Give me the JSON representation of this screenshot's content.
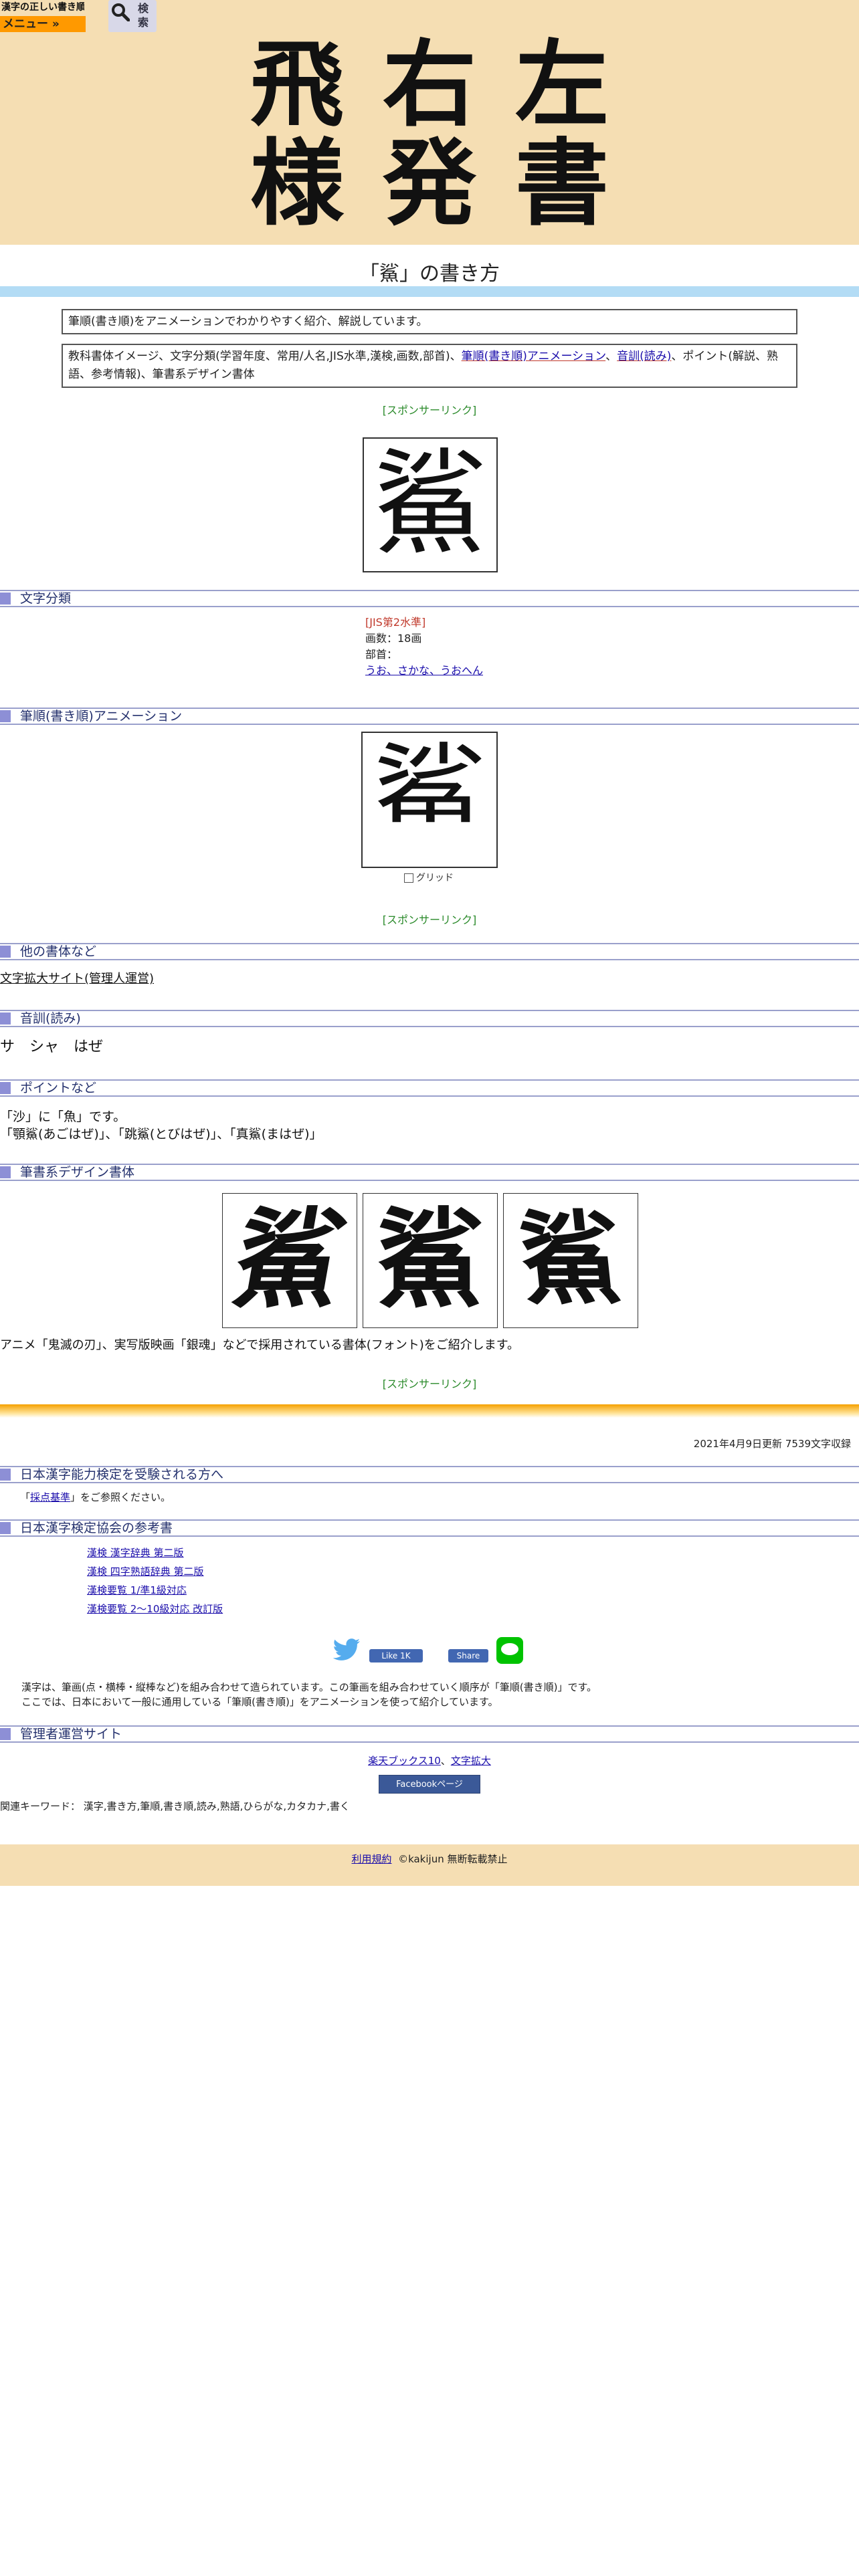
{
  "header": {
    "logo": "漢字の正しい書き順(筆順)",
    "menu_label": "メニュー »",
    "search_label": "検索"
  },
  "banner": {
    "chars_row1": [
      "飛",
      "右",
      "左"
    ],
    "chars_row2": [
      "様",
      "発",
      "書"
    ]
  },
  "page_title": "「鯊」の書き方",
  "intro": "筆順(書き順)をアニメーションでわかりやすく紹介、解説しています。",
  "contents_menu": {
    "prefix": "教科書体イメージ、文字分類(学習年度、常用/人名,JIS水準,漢検,画数,部首)、",
    "link1": "筆順(書き順)アニメーション",
    "sep": "、",
    "link2": "音訓(読み)",
    "suffix": "、ポイント(解説、熟語、参考情報)、筆書系デザイン書体"
  },
  "sponsor_label": "[スポンサーリンク]",
  "kanji": "鯊",
  "kanji_partial": "鯊",
  "sections": {
    "classification": "文字分類",
    "animation": "筆順(書き順)アニメーション",
    "other_fonts": "他の書体など",
    "readings": "音訓(読み)",
    "points": "ポイントなど",
    "brush_fonts": "筆書系デザイン書体",
    "kanken": "日本漢字能力検定を受験される方へ",
    "kanken_refs": "日本漢字検定協会の参考書",
    "admin_sites": "管理者運営サイト"
  },
  "classification": {
    "jis": "[JIS第2水準]",
    "strokes": "画数：18画",
    "radical_label": "部首：",
    "radical": "うお、さかな、うおへん"
  },
  "grid_label": "グリッド",
  "other_fonts_link": "文字拡大サイト(管理人運営)",
  "readings": "サ　シャ　はぜ",
  "points": {
    "line1": "「沙」に「魚」です。",
    "line2": "「顎鯊(あごはぜ)」、「跳鯊(とびはぜ)」、「真鯊(まはぜ)」"
  },
  "brush_note": "アニメ「鬼滅の刃」、実写版映画「銀魂」などで採用されている書体(フォント)をご紹介します。",
  "updated": "2021年4月9日更新 7539文字収録",
  "kanken_note_pre": "「",
  "kanken_note_link": "採点基準",
  "kanken_note_post": "」をご参照ください。",
  "kanken_refs": [
    "漢検 漢字辞典 第二版",
    "漢検 四字熟語辞典 第二版",
    "漢検要覧 1/準1級対応",
    "漢検要覧 2～10級対応 改訂版"
  ],
  "social": {
    "like": "Like 1K",
    "share": "Share"
  },
  "explain": {
    "line1": "漢字は、筆画(点・横棒・縦棒など)を組み合わせて造られています。この筆画を組み合わせていく順序が「筆順(書き順)」です。",
    "line2": "ここでは、日本において一般に通用している「筆順(書き順)」をアニメーションを使って紹介しています。"
  },
  "admin_links": {
    "link1": "楽天ブックス10",
    "sep": "、",
    "link2": "文字拡大"
  },
  "facebook_page": "Facebookページ",
  "keywords": "関連キーワード： 漢字,書き方,筆順,書き順,読み,熟語,ひらがな,カタカナ,書く",
  "footer": {
    "terms": "利用規約",
    "copyright": "©kakijun 無断転載禁止"
  },
  "colors": {
    "banner": "#f5deb3",
    "menu": "#ff9900",
    "section_mark": "#8d8fd6",
    "sponsor": "#2a8a2a",
    "jis": "#c0392b"
  }
}
